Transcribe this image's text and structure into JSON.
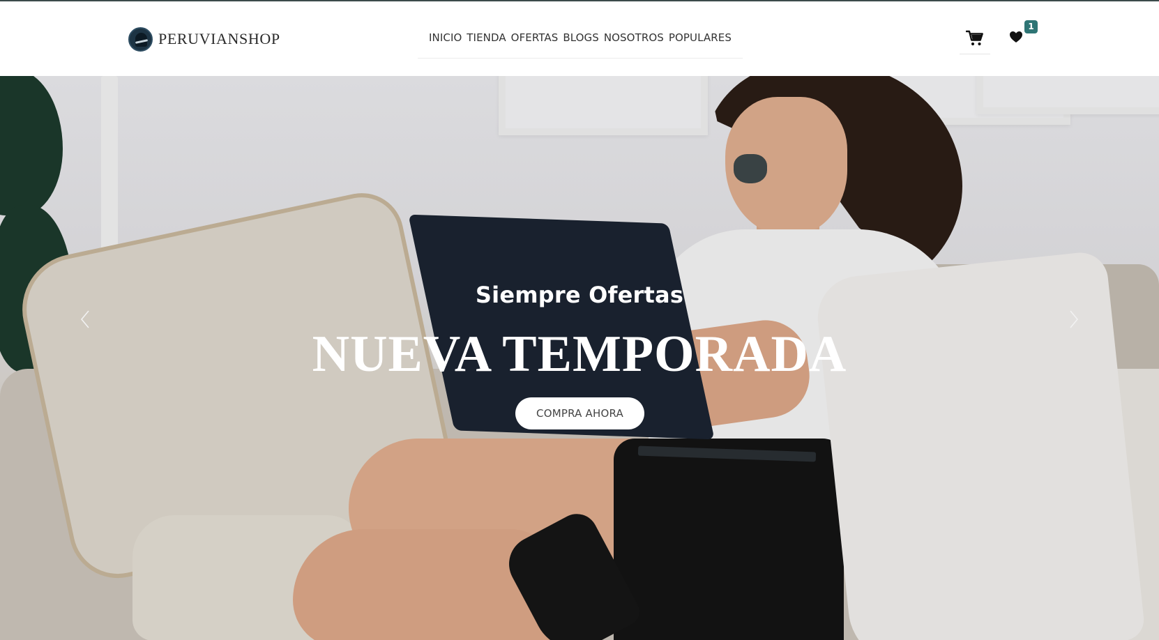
{
  "brand": {
    "name": "PERUVIANSHOP",
    "logo_icon": "peruvianshop-logo-icon"
  },
  "nav": {
    "items": [
      {
        "label": "INICIO"
      },
      {
        "label": "TIENDA"
      },
      {
        "label": "OFERTAS"
      },
      {
        "label": "BLOGS"
      },
      {
        "label": "NOSOTROS"
      },
      {
        "label": "POPULARES"
      }
    ]
  },
  "header_actions": {
    "cart_icon": "shopping-cart-icon",
    "wishlist_icon": "heart-icon",
    "wishlist_count": "1"
  },
  "hero": {
    "subtitle": "Siempre Ofertas",
    "title": "NUEVA TEMPORADA",
    "cta_label": "COMPRA AHORA",
    "prev_icon": "chevron-left-icon",
    "next_icon": "chevron-right-icon"
  },
  "colors": {
    "accent": "#2e7575",
    "header_bg": "#ffffff",
    "hero_text": "#ffffff"
  }
}
